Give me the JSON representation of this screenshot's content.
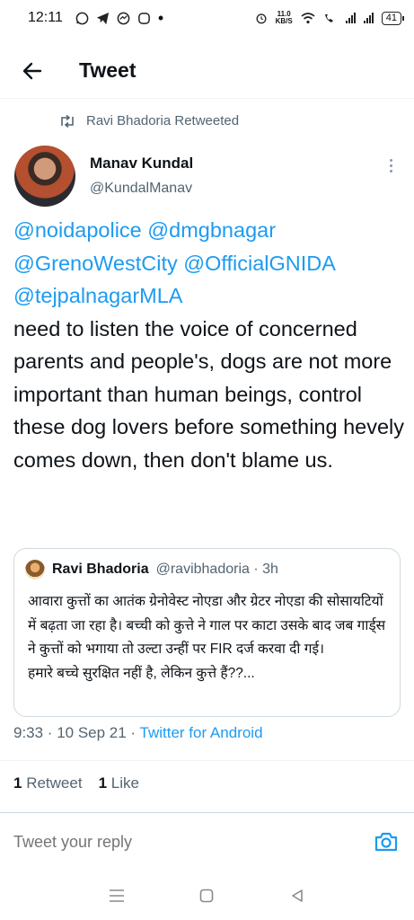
{
  "status_bar": {
    "time": "12:11",
    "net_speed_value": "11.0",
    "net_speed_unit": "KB/S",
    "battery": "41"
  },
  "header": {
    "title": "Tweet"
  },
  "retweet_context": {
    "text": "Ravi Bhadoria Retweeted"
  },
  "tweet": {
    "author_name": "Manav Kundal",
    "author_handle": "@KundalManav",
    "mentions": [
      "@noidapolice @dmgbnagar",
      "@GrenoWestCity @OfficialGNIDA",
      "@tejpalnagarMLA"
    ],
    "body": "need to listen the voice of concerned parents and people's, dogs are not more important than human beings, control these dog lovers before something hevely comes down, then don't blame us.",
    "time": "9:33 · 10 Sep 21 · ",
    "client": "Twitter for Android"
  },
  "quoted_tweet": {
    "author_name": "Ravi Bhadoria",
    "author_handle": "@ravibhadoria · 3h",
    "text": "आवारा कुत्तों का आतंक ग्रेनोवेस्ट नोएडा और ग्रेटर नोएडा की सोसायटियों में बढ़ता जा रहा है। बच्ची को कुत्ते ने गाल पर काटा उसके बाद जब गार्ड्स ने कुत्तों को भगाया तो उल्टा उन्हीं पर FIR दर्ज करवा दी गई।",
    "text2": "हमारे बच्चे सुरक्षित नहीं है, लेकिन कुत्ते हैं??..."
  },
  "stats": {
    "retweets_count": "1",
    "retweets_label": "Retweet",
    "likes_count": "1",
    "likes_label": "Like"
  },
  "reply": {
    "placeholder": "Tweet your reply"
  },
  "colors": {
    "link": "#1d9bf0",
    "secondary_text": "#536471",
    "border": "#cfd9de"
  }
}
